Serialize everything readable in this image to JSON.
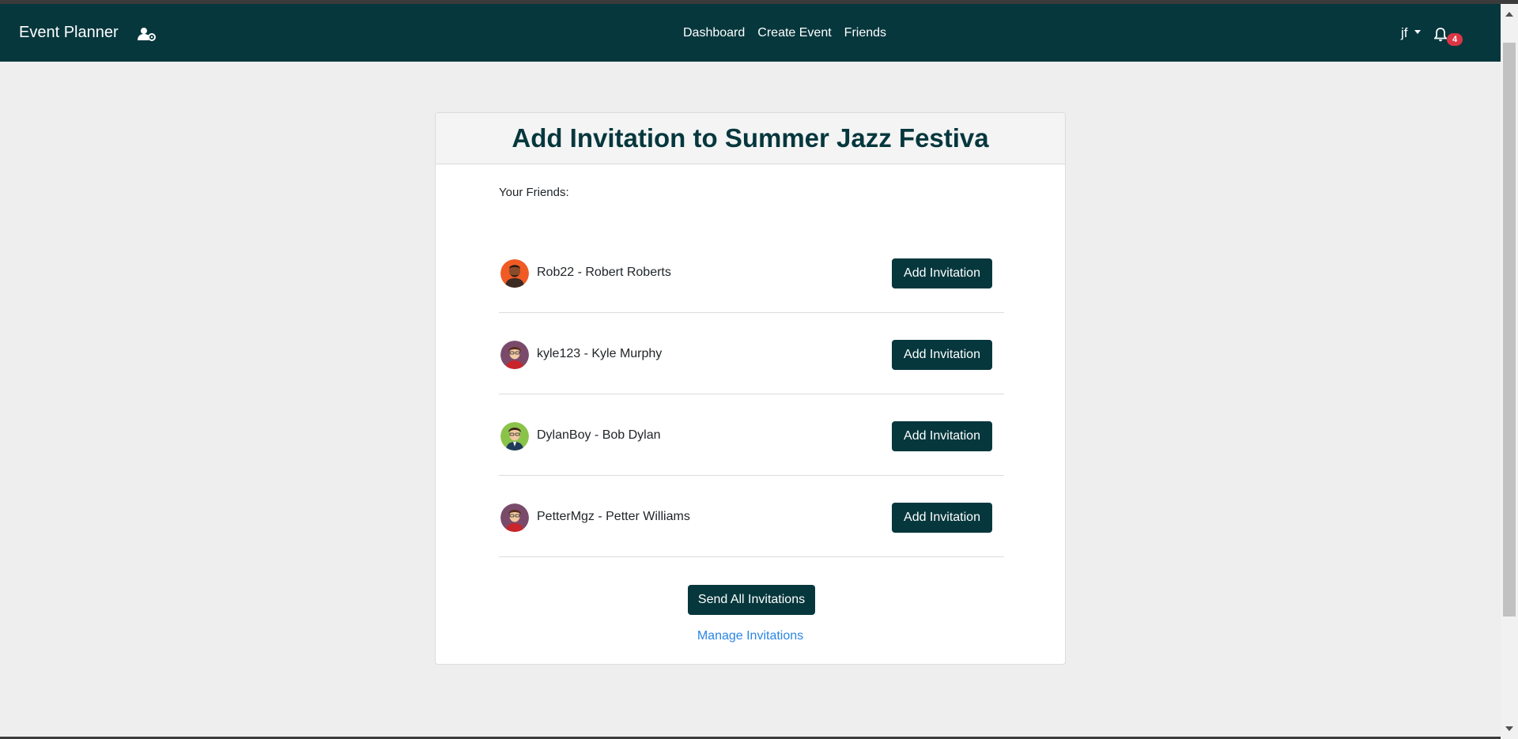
{
  "navbar": {
    "brand": "Event Planner",
    "links": [
      "Dashboard",
      "Create Event",
      "Friends"
    ],
    "user": "jf",
    "notification_count": "4",
    "background": "#06373d"
  },
  "card": {
    "title": "Add Invitation to Summer Jazz Festiva",
    "friends_label": "Your Friends:",
    "friends": [
      {
        "name": "Rob22 - Robert Roberts",
        "button": "Add Invitation",
        "avatar": "avatar-orange-icon"
      },
      {
        "name": "kyle123 - Kyle Murphy",
        "button": "Add Invitation",
        "avatar": "avatar-purple-icon"
      },
      {
        "name": "DylanBoy - Bob Dylan",
        "button": "Add Invitation",
        "avatar": "avatar-green-icon"
      },
      {
        "name": "PetterMgz - Petter Williams",
        "button": "Add Invitation",
        "avatar": "avatar-purple-icon"
      }
    ],
    "send_all_label": "Send All Invitations",
    "manage_label": "Manage Invitations"
  },
  "colors": {
    "accent": "#06373d",
    "link": "#2b85e4",
    "badge": "#dc3545"
  }
}
